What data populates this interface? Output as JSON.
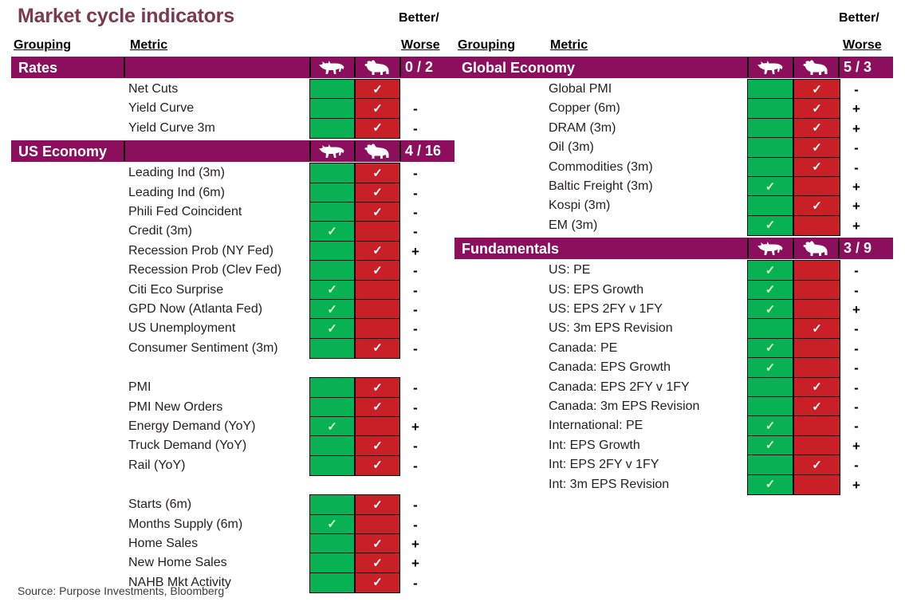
{
  "title": "Market cycle indicators",
  "source": "Source: Purpose Investments, Bloomberg",
  "headers": {
    "grouping": "Grouping",
    "metric": "Metric",
    "better": "Better/",
    "worse": "Worse"
  },
  "icons": {
    "bull": "bull-icon",
    "bear": "bear-icon"
  },
  "colors": {
    "header_purple": "#8c0f5e",
    "green": "#07b154",
    "red": "#c92028",
    "title": "#7d3950",
    "text": "#231f20"
  },
  "left_column": {
    "groups": [
      {
        "name": "Rates",
        "score": "0 / 2",
        "blocks": [
          {
            "rows": [
              {
                "metric": "Net Cuts",
                "bull": false,
                "bear": true,
                "sign": ""
              },
              {
                "metric": "Yield Curve",
                "bull": false,
                "bear": true,
                "sign": "-"
              },
              {
                "metric": "Yield Curve 3m",
                "bull": false,
                "bear": true,
                "sign": "-"
              }
            ]
          }
        ]
      },
      {
        "name": "US Economy",
        "score": "4 / 16",
        "blocks": [
          {
            "rows": [
              {
                "metric": "Leading Ind (3m)",
                "bull": false,
                "bear": true,
                "sign": "-"
              },
              {
                "metric": "Leading Ind (6m)",
                "bull": false,
                "bear": true,
                "sign": "-"
              },
              {
                "metric": "Phili Fed Coincident",
                "bull": false,
                "bear": true,
                "sign": "-"
              },
              {
                "metric": "Credit (3m)",
                "bull": true,
                "bear": false,
                "sign": "-"
              },
              {
                "metric": "Recession Prob (NY Fed)",
                "bull": false,
                "bear": true,
                "sign": "+"
              },
              {
                "metric": "Recession Prob (Clev Fed)",
                "bull": false,
                "bear": true,
                "sign": "-"
              },
              {
                "metric": "Citi Eco Surprise",
                "bull": true,
                "bear": false,
                "sign": "-"
              },
              {
                "metric": "GPD Now (Atlanta Fed)",
                "bull": true,
                "bear": false,
                "sign": "-"
              },
              {
                "metric": "US Unemployment",
                "bull": true,
                "bear": false,
                "sign": "-"
              },
              {
                "metric": "Consumer Sentiment (3m)",
                "bull": false,
                "bear": true,
                "sign": "-"
              }
            ]
          },
          {
            "rows": [
              {
                "metric": "PMI",
                "bull": false,
                "bear": true,
                "sign": "-"
              },
              {
                "metric": "PMI New Orders",
                "bull": false,
                "bear": true,
                "sign": "-"
              },
              {
                "metric": "Energy Demand (YoY)",
                "bull": true,
                "bear": false,
                "sign": "+"
              },
              {
                "metric": "Truck Demand (YoY)",
                "bull": false,
                "bear": true,
                "sign": "-"
              },
              {
                "metric": "Rail (YoY)",
                "bull": false,
                "bear": true,
                "sign": "-"
              }
            ]
          },
          {
            "rows": [
              {
                "metric": "Starts (6m)",
                "bull": false,
                "bear": true,
                "sign": "-"
              },
              {
                "metric": "Months Supply (6m)",
                "bull": true,
                "bear": false,
                "sign": "-"
              },
              {
                "metric": "Home Sales",
                "bull": false,
                "bear": true,
                "sign": "+"
              },
              {
                "metric": "New Home Sales",
                "bull": false,
                "bear": true,
                "sign": "+"
              },
              {
                "metric": "NAHB Mkt Activity",
                "bull": false,
                "bear": true,
                "sign": "-"
              }
            ]
          }
        ]
      }
    ]
  },
  "right_column": {
    "groups": [
      {
        "name": "Global Economy",
        "score": "5 / 3",
        "blocks": [
          {
            "rows": [
              {
                "metric": "Global PMI",
                "bull": false,
                "bear": true,
                "sign": "-"
              },
              {
                "metric": "Copper (6m)",
                "bull": false,
                "bear": true,
                "sign": "+"
              },
              {
                "metric": "DRAM (3m)",
                "bull": false,
                "bear": true,
                "sign": "+"
              },
              {
                "metric": "Oil (3m)",
                "bull": false,
                "bear": true,
                "sign": "-"
              },
              {
                "metric": "Commodities (3m)",
                "bull": false,
                "bear": true,
                "sign": "-"
              },
              {
                "metric": "Baltic Freight (3m)",
                "bull": true,
                "bear": false,
                "sign": "+"
              },
              {
                "metric": "Kospi (3m)",
                "bull": false,
                "bear": true,
                "sign": "+"
              },
              {
                "metric": "EM (3m)",
                "bull": true,
                "bear": false,
                "sign": "+"
              }
            ]
          }
        ]
      },
      {
        "name": "Fundamentals",
        "score": "3 / 9",
        "blocks": [
          {
            "rows": [
              {
                "metric": "US: PE",
                "bull": true,
                "bear": false,
                "sign": "-"
              },
              {
                "metric": "US: EPS Growth",
                "bull": true,
                "bear": false,
                "sign": "-"
              },
              {
                "metric": "US: EPS 2FY v 1FY",
                "bull": true,
                "bear": false,
                "sign": "+"
              },
              {
                "metric": "US: 3m EPS Revision",
                "bull": false,
                "bear": true,
                "sign": "-"
              },
              {
                "metric": "Canada: PE",
                "bull": true,
                "bear": false,
                "sign": "-"
              },
              {
                "metric": "Canada: EPS Growth",
                "bull": true,
                "bear": false,
                "sign": "-"
              },
              {
                "metric": "Canada: EPS 2FY v 1FY",
                "bull": false,
                "bear": true,
                "sign": "-"
              },
              {
                "metric": "Canada: 3m EPS Revision",
                "bull": false,
                "bear": true,
                "sign": "-"
              },
              {
                "metric": "International: PE",
                "bull": true,
                "bear": false,
                "sign": "-"
              },
              {
                "metric": "Int: EPS Growth",
                "bull": true,
                "bear": false,
                "sign": "+"
              },
              {
                "metric": "Int: EPS 2FY v 1FY",
                "bull": false,
                "bear": true,
                "sign": "-"
              },
              {
                "metric": "Int: 3m EPS Revision",
                "bull": true,
                "bear": false,
                "sign": "+"
              }
            ]
          }
        ]
      }
    ]
  }
}
